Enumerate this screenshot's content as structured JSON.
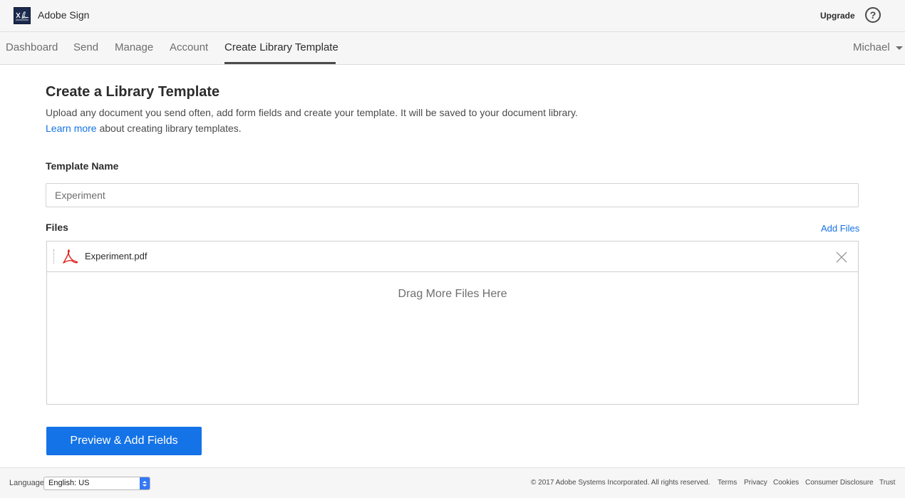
{
  "header": {
    "app_title": "Adobe Sign",
    "upgrade_label": "Upgrade",
    "help_glyph": "?"
  },
  "nav": {
    "items": [
      {
        "label": "Dashboard"
      },
      {
        "label": "Send"
      },
      {
        "label": "Manage"
      },
      {
        "label": "Account"
      },
      {
        "label": "Create Library Template"
      }
    ],
    "user_name": "Michael"
  },
  "main": {
    "title": "Create a Library Template",
    "intro_before": "Upload any document you send often, add form fields and create your template. It will be saved to your document library. ",
    "intro_link": "Learn more",
    "intro_after": " about creating library templates.",
    "template_name_label": "Template Name",
    "template_name_value": "Experiment",
    "files_label": "Files",
    "add_files_label": "Add Files",
    "files": [
      {
        "name": "Experiment.pdf"
      }
    ],
    "drop_text": "Drag More Files Here",
    "primary_button": "Preview & Add Fields"
  },
  "footer": {
    "language_label": "Language",
    "language_value": "English: US",
    "copyright": "© 2017 Adobe Systems Incorporated. All rights reserved.",
    "links": [
      "Terms",
      "Privacy",
      "Cookies",
      "Consumer Disclosure",
      "Trust"
    ]
  },
  "colors": {
    "accent": "#1473e6",
    "pdf_red": "#e0201b",
    "logo_bg": "#1c2a4d"
  }
}
